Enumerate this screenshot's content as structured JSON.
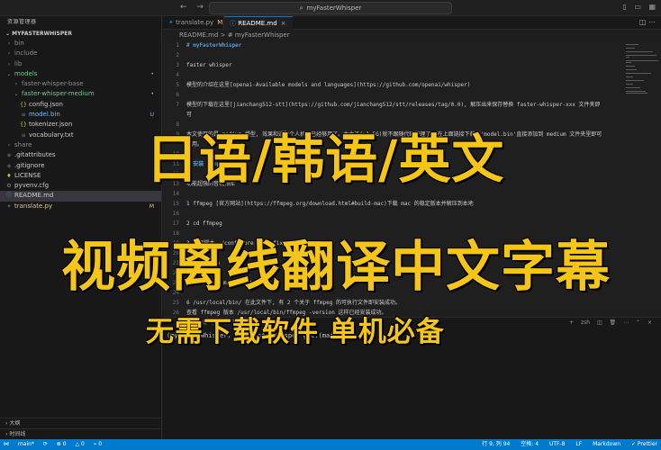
{
  "titlebar": {
    "back": "←",
    "forward": "→",
    "search": "myFasterWhisper"
  },
  "sidebar": {
    "title": "资源管理器",
    "root": "MYFASTERWHISPER",
    "items": [
      {
        "label": "bin",
        "icon": "chevron-right",
        "indent": 1,
        "color": "dim"
      },
      {
        "label": "include",
        "icon": "chevron-right",
        "indent": 1,
        "color": "dim"
      },
      {
        "label": "lib",
        "icon": "chevron-right",
        "indent": 1,
        "color": "dim"
      },
      {
        "label": "models",
        "icon": "chevron-down",
        "indent": 1,
        "color": "green",
        "badge": "•"
      },
      {
        "label": "faster-whisper-base",
        "icon": "chevron-right",
        "indent": 2,
        "color": "dim"
      },
      {
        "label": "faster-whisper-medium",
        "icon": "chevron-down",
        "indent": 2,
        "color": "green",
        "badge": "•"
      },
      {
        "label": "config.json",
        "icon": "{}",
        "indent": 3,
        "color": "normal"
      },
      {
        "label": "model.bin",
        "icon": "≡",
        "indent": 3,
        "color": "blue",
        "badge": "U"
      },
      {
        "label": "tokenizer.json",
        "icon": "{}",
        "indent": 3,
        "color": "normal"
      },
      {
        "label": "vocabulary.txt",
        "icon": "≡",
        "indent": 3,
        "color": "normal"
      },
      {
        "label": "share",
        "icon": "chevron-right",
        "indent": 1,
        "color": "dim"
      },
      {
        "label": ".gitattributes",
        "icon": "◆",
        "indent": 1,
        "color": "normal"
      },
      {
        "label": ".gitignore",
        "icon": "◆",
        "indent": 1,
        "color": "normal"
      },
      {
        "label": "LICENSE",
        "icon": "♦",
        "indent": 1,
        "color": "normal"
      },
      {
        "label": "pyvenv.cfg",
        "icon": "⚙",
        "indent": 1,
        "color": "normal"
      },
      {
        "label": "README.md",
        "icon": "ⓘ",
        "indent": 1,
        "color": "normal",
        "selected": true
      },
      {
        "label": "translate.py",
        "icon": "✦",
        "indent": 1,
        "color": "mod",
        "badge": "M"
      }
    ],
    "outline": "大纲",
    "timeline": "时间线"
  },
  "tabs": [
    {
      "label": "translate.py",
      "suffix": "M"
    },
    {
      "label": "README.md",
      "suffix": "×"
    }
  ],
  "breadcrumb": "README.md > # myFasterWhisper",
  "editor": {
    "lines": [
      {
        "n": "1",
        "text": "# myFasterWhisper",
        "style": "h"
      },
      {
        "n": "2",
        "text": ""
      },
      {
        "n": "3",
        "text": "faster whisper"
      },
      {
        "n": "4",
        "text": ""
      },
      {
        "n": "5",
        "text": "模型的介绍在这里[openai-Available models and languages](https://github.com/openai/whisper)"
      },
      {
        "n": "6",
        "text": ""
      },
      {
        "n": "7",
        "text": "模型的下载在这里[jianchang512-stt](https://github.com/jianchang512/stt/releases/tag/0.0), 解压出来保存替换 faster-whisper-xxx 文件夹即"
      },
      {
        "n": "",
        "text": "可"
      },
      {
        "n": "8",
        "text": ""
      },
      {
        "n": "9",
        "text": "本文使用的是 medium 模型, 效果和适配个人机器已经够用了。太大了(>1.5G)就不跟随代码管理了, 在上面链接下载后'model.bin'直接添加到 medium 文件夹里即可"
      },
      {
        "n": "",
        "text": "使用。"
      },
      {
        "n": "10",
        "text": ""
      },
      {
        "n": "11",
        "text": "# 安装 ffmpeg",
        "style": "h"
      },
      {
        "n": "12",
        "text": ""
      },
      {
        "n": "13",
        "text": "功能超强的音视频库"
      },
      {
        "n": "14",
        "text": ""
      },
      {
        "n": "15",
        "text": "1  ffmpeg [官方网站](https://ffmpeg.org/download.html#build-mac)下载 mac 的稳定版本并解压到本地"
      },
      {
        "n": "16",
        "text": ""
      },
      {
        "n": "17",
        "text": "2 cd ffmpeg"
      },
      {
        "n": "18",
        "text": ""
      },
      {
        "n": "19",
        "text": "3 执行脚本 ./configure --prefix=/usr/local"
      },
      {
        "n": "20",
        "text": ""
      },
      {
        "n": "21",
        "text": "4 执行 make"
      },
      {
        "n": "22",
        "text": ""
      },
      {
        "n": "23",
        "text": "5 安装 sudo make install"
      },
      {
        "n": "24",
        "text": ""
      },
      {
        "n": "25",
        "text": "6 /usr/local/bin/ 在此文件下, 有 2 个关于 ffmpeg 的可执行文件即安装成功。"
      },
      {
        "n": "26",
        "text": "查看  ffmpeg 版本  /usr/local/bin/ffmpeg -version 这样已经安装成功。"
      }
    ]
  },
  "panel": {
    "tabs": [
      "问题",
      "输出",
      "调试控制台",
      "终端"
    ],
    "shell": "zsh",
    "terminal": "(myFasterWhisper) →  myFasterWhisper git:(main) ✗ ▯"
  },
  "overlay": {
    "line1": "日语/韩语/英文",
    "line2": "视频离线翻译中文字幕",
    "line3": "无需下载软件  单机必备"
  },
  "statusbar": {
    "branch": "main*",
    "sync": "⟳",
    "errors": "⊗ 0",
    "warnings": "△ 0",
    "ports": "⌁ 0",
    "position": "行 9, 列 94",
    "spaces": "空格: 4",
    "encoding": "UTF-8",
    "eol": "LF",
    "language": "Markdown",
    "prettier": "✓ Prettier"
  }
}
